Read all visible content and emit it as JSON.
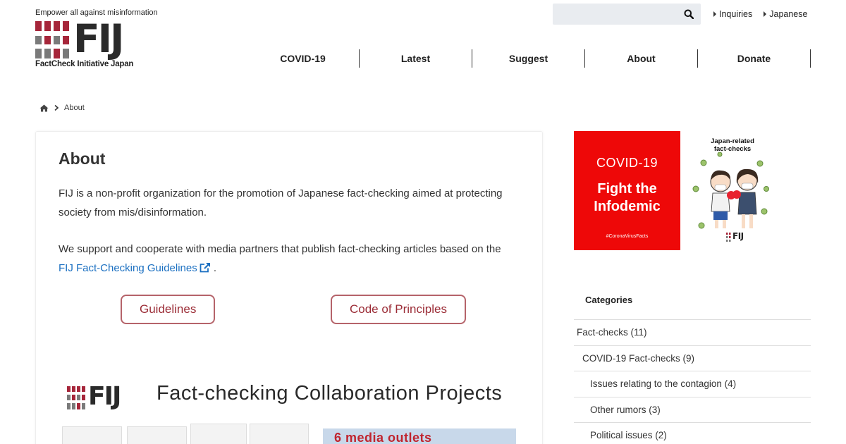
{
  "header": {
    "tagline": "Empower all against misinformation",
    "logo_letters": "FIJ",
    "logo_subtitle": "FactCheck Initiative Japan",
    "search_placeholder": "",
    "top_links": [
      "Inquiries",
      "Japanese"
    ]
  },
  "nav": [
    "COVID-19",
    "Latest",
    "Suggest",
    "About",
    "Donate"
  ],
  "breadcrumb": {
    "current": "About"
  },
  "main": {
    "title": "About",
    "para1": "FIJ is a non-profit organization for the promotion of Japanese fact-checking aimed at protecting society from mis/disinformation.",
    "para2_text": "We support and cooperate with media partners that publish fact-checking articles based on the",
    "para2_link": "FIJ Fact-Checking Guidelines",
    "para2_end": ".",
    "buttons": [
      "Guidelines",
      "Code of Principles"
    ],
    "banner": {
      "fij": "FIJ",
      "title": "Fact-checking Collaboration Projects",
      "media_text": "6 media outlets"
    }
  },
  "sidebar": {
    "covid": {
      "title": "COVID-19",
      "fight_line1": "Fight the",
      "fight_line2": "Infodemic",
      "tag": "#CoronaVirusFacts"
    },
    "japan": {
      "title_line1": "Japan-related",
      "title_line2": "fact-checks",
      "fij": "FIJ"
    },
    "categories_heading": "Categories",
    "categories": [
      {
        "label": "Fact-checks (11)",
        "level": 0
      },
      {
        "label": "COVID-19 Fact-checks (9)",
        "level": 1
      },
      {
        "label": "Issues relating to the contagion (4)",
        "level": 2
      },
      {
        "label": "Other rumors (3)",
        "level": 2
      },
      {
        "label": "Political issues (2)",
        "level": 2
      }
    ]
  },
  "colors": {
    "logo_red": "#a6263a",
    "logo_gray": "#7a7a7a",
    "link_blue": "#1a6fc1",
    "button_border": "#b5636a",
    "covid_red": "#ee0808"
  }
}
